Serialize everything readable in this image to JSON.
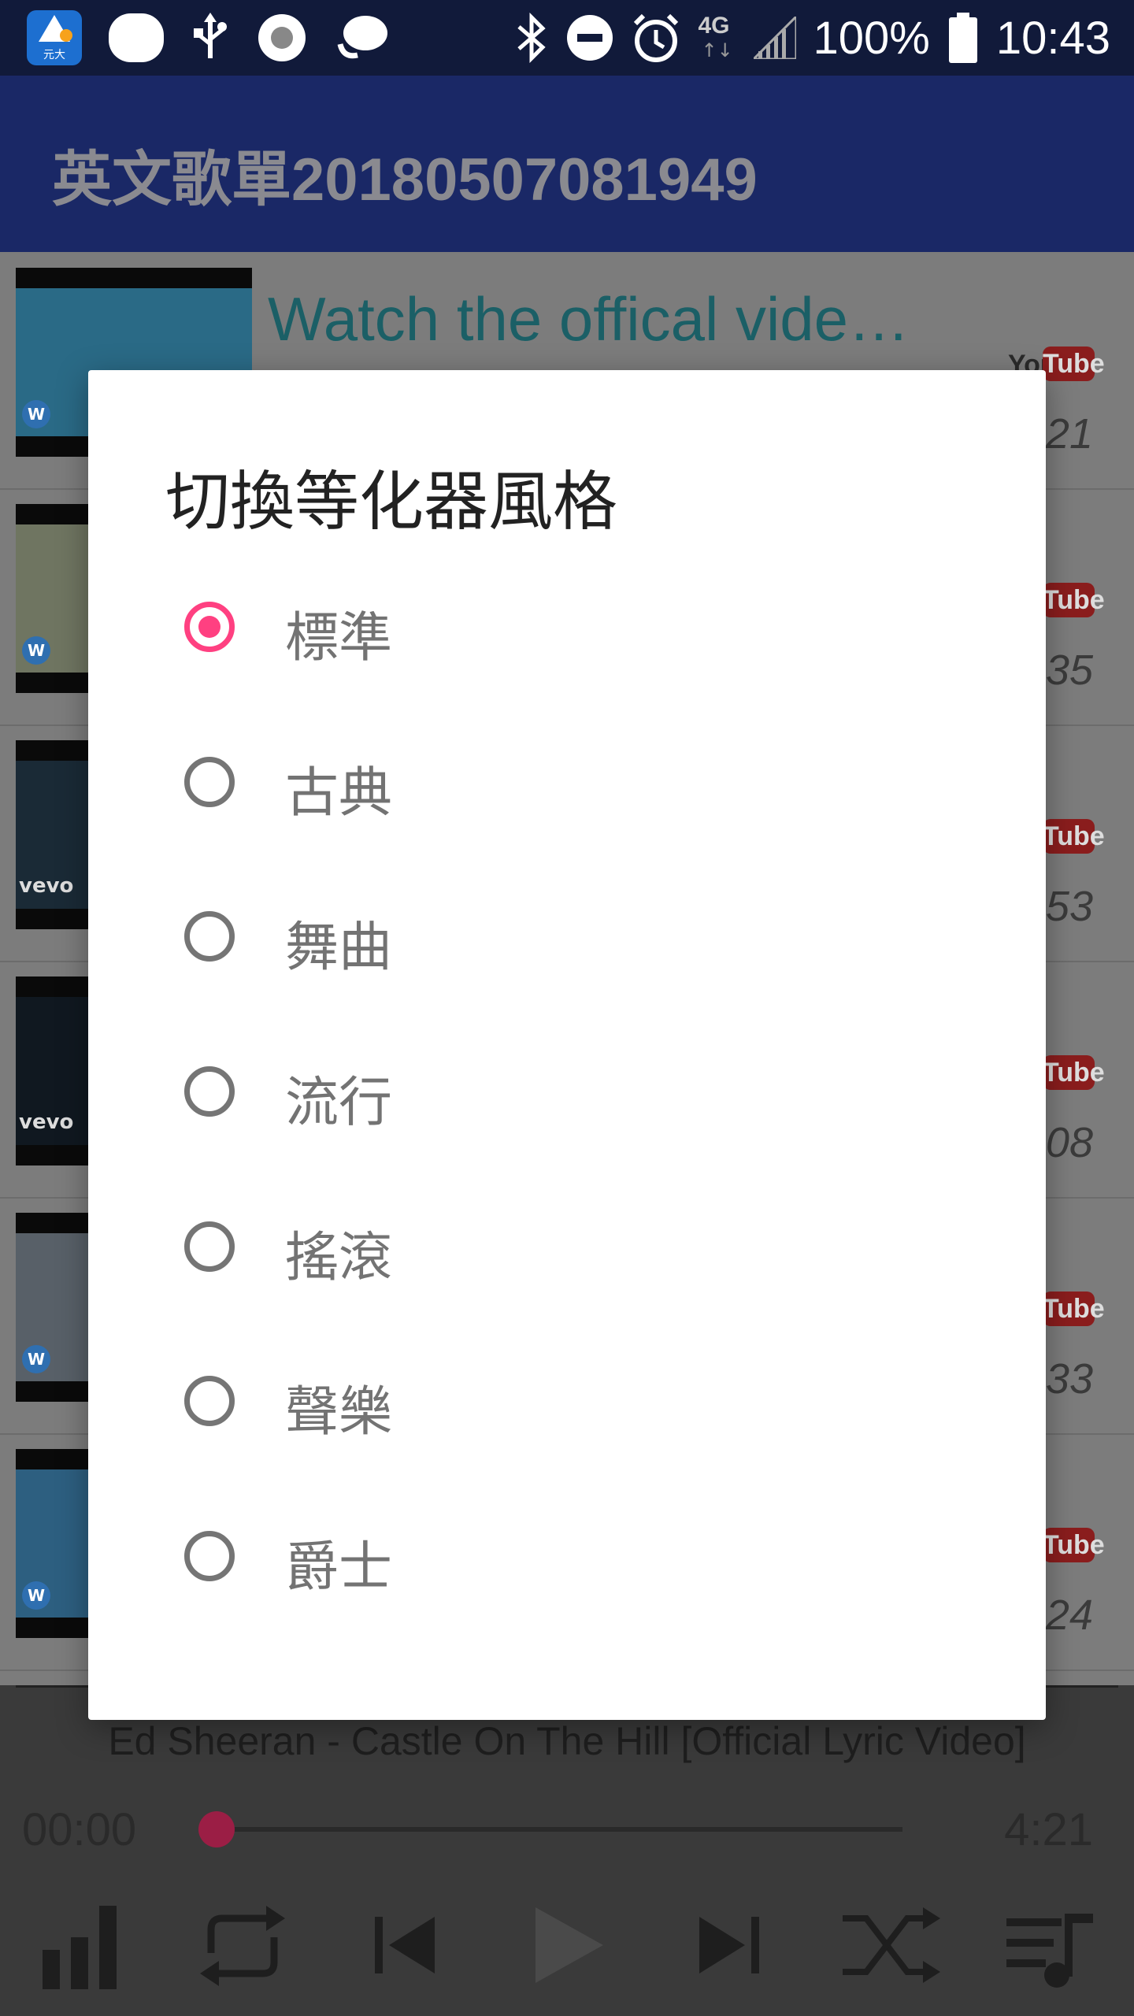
{
  "status_bar": {
    "app_badge_label": "元大",
    "battery_text": "100%",
    "network_text": "4G",
    "time": "10:43",
    "icons": [
      "app-badge-icon",
      "notification-pill-icon",
      "usb-icon",
      "record-icon",
      "chat-icon",
      "bluetooth-icon",
      "do-not-disturb-icon",
      "alarm-icon",
      "network-icon",
      "signal-icon",
      "battery-icon"
    ]
  },
  "app_bar": {
    "title": "英文歌單20180507081949"
  },
  "song_list": [
    {
      "title": "Watch the offical vide…",
      "duration": "4:21",
      "thumb_color": "#2a6a86",
      "logo": "W"
    },
    {
      "title": "",
      "duration": "3:35",
      "thumb_color": "#6f7561",
      "logo": "W"
    },
    {
      "title": "",
      "duration": "3:53",
      "thumb_color": "#1a2a36",
      "logo": "vevo"
    },
    {
      "title": "",
      "duration": "4:08",
      "thumb_color": "#101820",
      "logo": "vevo"
    },
    {
      "title": "",
      "duration": "4:33",
      "thumb_color": "#586068",
      "logo": "W"
    },
    {
      "title": "",
      "duration": "3:24",
      "thumb_color": "#2d5f80",
      "logo": "W"
    }
  ],
  "youtube_badge": {
    "you": "You",
    "tube": "Tube"
  },
  "player": {
    "now_playing": "Ed Sheeran - Castle On The Hill [Official Lyric Video]",
    "current_time": "00:00",
    "total_time": "4:21",
    "progress_fraction": 0.0,
    "controls": [
      "equalizer-icon",
      "repeat-icon",
      "previous-icon",
      "play-icon",
      "next-icon",
      "shuffle-icon",
      "playlist-icon"
    ]
  },
  "dialog": {
    "title": "切換等化器風格",
    "options": [
      {
        "label": "標準",
        "checked": true
      },
      {
        "label": "古典",
        "checked": false
      },
      {
        "label": "舞曲",
        "checked": false
      },
      {
        "label": "流行",
        "checked": false
      },
      {
        "label": "搖滾",
        "checked": false
      },
      {
        "label": "聲樂",
        "checked": false
      },
      {
        "label": "爵士",
        "checked": false
      }
    ]
  },
  "colors": {
    "accent": "#ff4081",
    "app_bar": "#1a2866",
    "status_bar": "#111a3a",
    "radio_unchecked": "#757575"
  }
}
